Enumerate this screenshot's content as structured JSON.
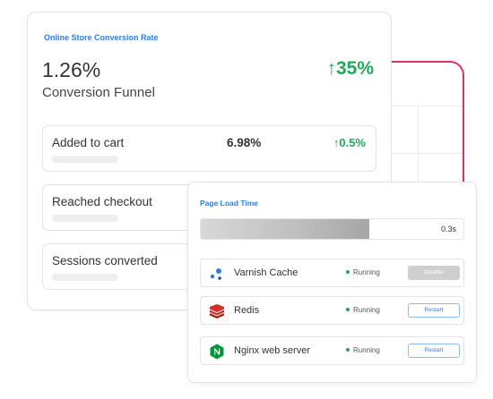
{
  "conversion": {
    "title": "Online Store Conversion Rate",
    "rate": "1.26%",
    "change_arrow": "↑",
    "change": "35%",
    "subtitle": "Conversion Funnel",
    "funnel": [
      {
        "label": "Added to cart",
        "value": "6.98%",
        "change_arrow": "↑",
        "change": "0.5%"
      },
      {
        "label": "Reached checkout"
      },
      {
        "label": "Sessions converted"
      }
    ]
  },
  "page_load": {
    "title": "Page Load Time",
    "bar_fill_fraction": 0.64,
    "value": "0.3s",
    "services": [
      {
        "name": "Varnish Cache",
        "status": "Running",
        "button": "Disable",
        "button_state": "disabled",
        "icon": "varnish-icon"
      },
      {
        "name": "Redis",
        "status": "Running",
        "button": "Restart",
        "button_state": "enabled",
        "icon": "redis-icon"
      },
      {
        "name": "Nginx web server",
        "status": "Running",
        "button": "Restart",
        "button_state": "enabled",
        "icon": "nginx-icon"
      }
    ]
  },
  "colors": {
    "accent_blue": "#2f7ee2",
    "positive_green": "#22a85a",
    "connector_pink": "#e1306c",
    "redis_red": "#c6302b",
    "nginx_green": "#009639"
  }
}
